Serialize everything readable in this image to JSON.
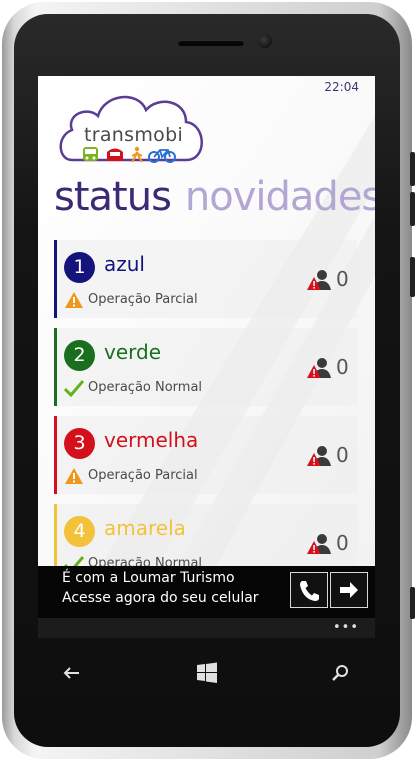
{
  "status_bar": {
    "time": "22:04"
  },
  "logo": {
    "text": "transmobi",
    "transport_icons": [
      "bus-icon",
      "train-icon",
      "walk-icon",
      "bike-icon"
    ]
  },
  "pivot": {
    "active": "status",
    "next": "novidades"
  },
  "lines": [
    {
      "number": "1",
      "name": "azul",
      "color": "#14147a",
      "status": "Operação Parcial",
      "status_icon": "warning-icon",
      "reports": "0"
    },
    {
      "number": "2",
      "name": "verde",
      "color": "#1a6f1e",
      "status": "Operação Normal",
      "status_icon": "check-icon",
      "reports": "0"
    },
    {
      "number": "3",
      "name": "vermelha",
      "color": "#d3101b",
      "status": "Operação Parcial",
      "status_icon": "warning-icon",
      "reports": "0"
    },
    {
      "number": "4",
      "name": "amarela",
      "color": "#f2c23a",
      "status": "Operação Normal",
      "status_icon": "check-icon",
      "reports": "0"
    }
  ],
  "ad": {
    "line1": "É com a Loumar Turismo",
    "line2": "Acesse agora do seu celular"
  },
  "colors": {
    "brand_purple": "#3b2a72",
    "pivot_inactive": "#b2a6d2",
    "warning": "#f0961c",
    "check": "#5fb51b"
  }
}
